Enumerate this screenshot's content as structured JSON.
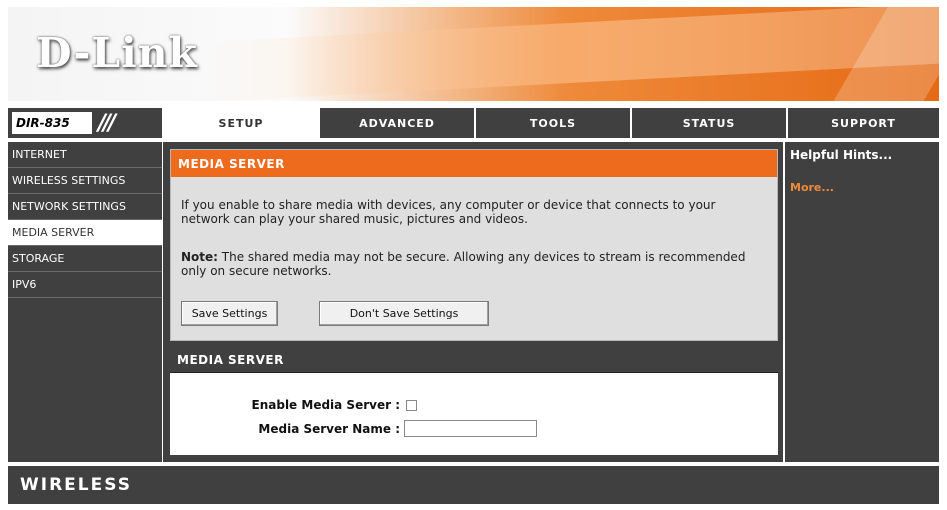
{
  "brand": {
    "logo_text": "D-Link",
    "model": "DIR-835",
    "model_bars": "///"
  },
  "nav": {
    "tabs": [
      {
        "label": "SETUP",
        "active": true
      },
      {
        "label": "ADVANCED",
        "active": false
      },
      {
        "label": "TOOLS",
        "active": false
      },
      {
        "label": "STATUS",
        "active": false
      },
      {
        "label": "SUPPORT",
        "active": false
      }
    ]
  },
  "sidebar": {
    "items": [
      {
        "label": "INTERNET",
        "active": false
      },
      {
        "label": "WIRELESS SETTINGS",
        "active": false
      },
      {
        "label": "NETWORK SETTINGS",
        "active": false
      },
      {
        "label": "MEDIA SERVER",
        "active": true
      },
      {
        "label": "STORAGE",
        "active": false
      },
      {
        "label": "IPV6",
        "active": false
      }
    ]
  },
  "info_section": {
    "title": "MEDIA SERVER",
    "description": "If you enable to share media with devices, any computer or device that connects to your network can play your shared music, pictures and videos.",
    "note_label": "Note:",
    "note_text": " The shared media may not be secure. Allowing any devices to stream is recommended only on secure networks.",
    "save_button": "Save Settings",
    "dont_save_button": "Don't Save Settings"
  },
  "settings_section": {
    "title": "MEDIA SERVER",
    "enable_label": "Enable Media Server :",
    "enable_checked": false,
    "name_label": "Media Server Name :",
    "name_value": ""
  },
  "support": {
    "hints_title": "Helpful Hints...",
    "more_link": "More..."
  },
  "footer": {
    "text": "WIRELESS"
  },
  "colors": {
    "accent_orange": "#ee6a1c",
    "dark_gray": "#404040",
    "link_orange": "#f08a3a"
  }
}
